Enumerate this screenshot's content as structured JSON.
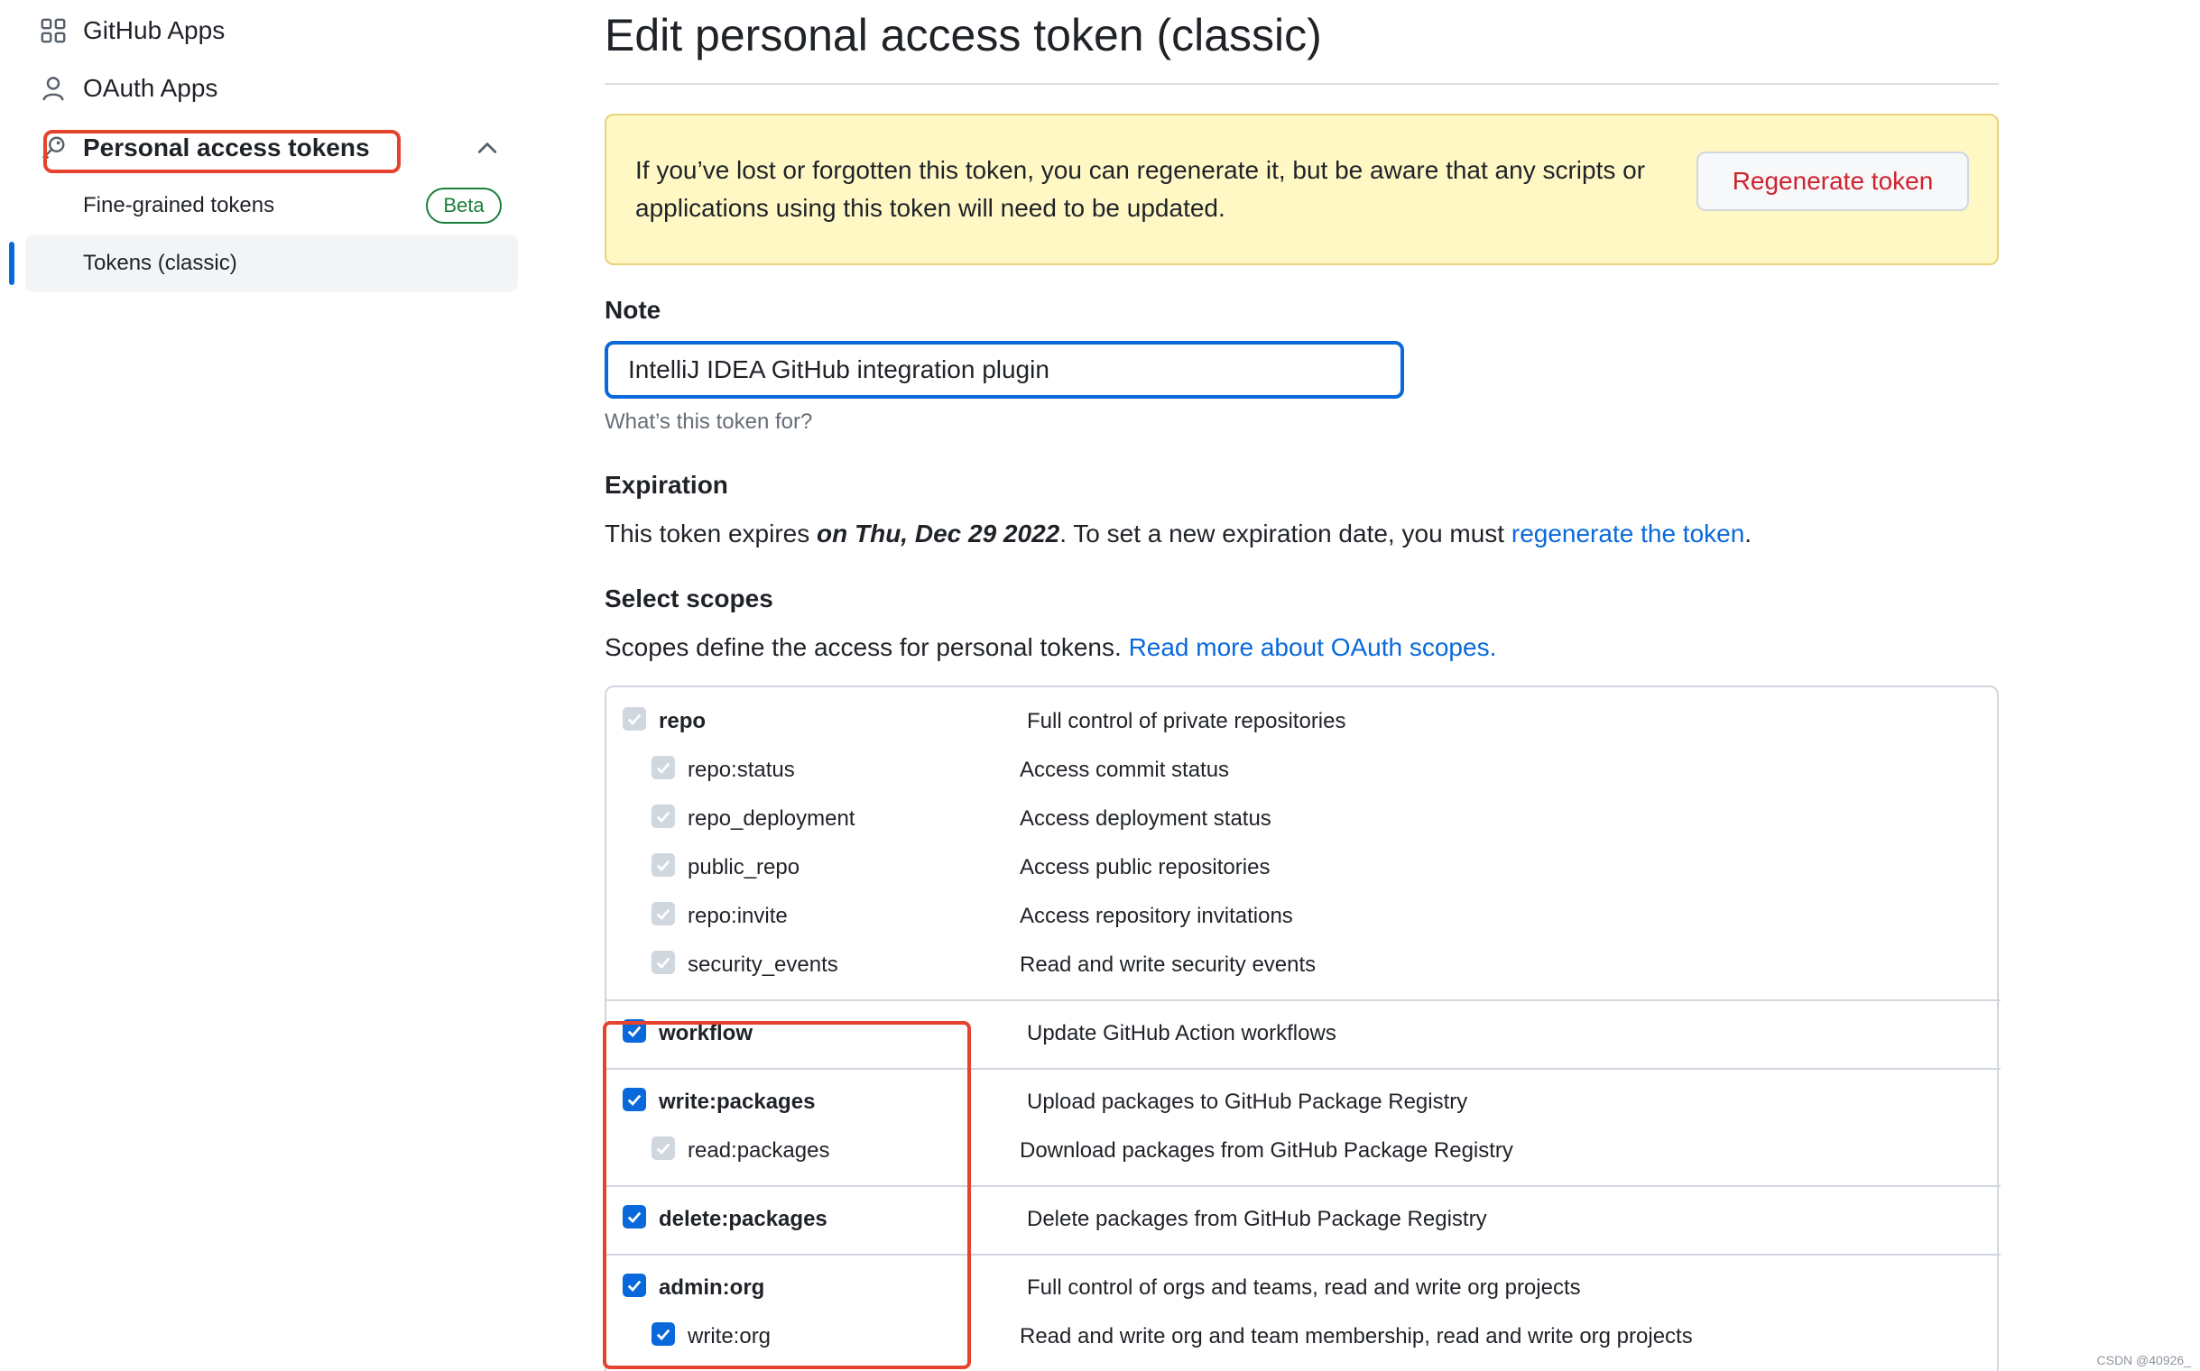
{
  "sidebar": {
    "items": [
      {
        "label": "GitHub Apps",
        "icon": "apps-grid-icon"
      },
      {
        "label": "OAuth Apps",
        "icon": "person-icon"
      },
      {
        "label": "Personal access tokens",
        "icon": "key-icon",
        "expanded": true
      }
    ],
    "sub_items": [
      {
        "label": "Fine-grained tokens",
        "badge": "Beta"
      },
      {
        "label": "Tokens (classic)",
        "selected": true
      }
    ]
  },
  "main": {
    "title": "Edit personal access token (classic)",
    "flash": {
      "message": "If you’ve lost or forgotten this token, you can regenerate it, but be aware that any scripts or applications using this token will need to be updated.",
      "button": "Regenerate token"
    },
    "note": {
      "label": "Note",
      "value": "IntelliJ IDEA GitHub integration plugin",
      "hint": "What’s this token for?"
    },
    "expiration": {
      "label": "Expiration",
      "text_before": "This token expires ",
      "date": "on Thu, Dec 29 2022",
      "text_after": ". To set a new expiration date, you must ",
      "link": "regenerate the token",
      "text_end": "."
    },
    "scopes": {
      "label": "Select scopes",
      "intro": "Scopes define the access for personal tokens. ",
      "intro_link": "Read more about OAuth scopes.",
      "groups": [
        {
          "name": "repo",
          "desc": "Full control of private repositories",
          "checked": false,
          "disabled": true,
          "children": [
            {
              "name": "repo:status",
              "desc": "Access commit status"
            },
            {
              "name": "repo_deployment",
              "desc": "Access deployment status"
            },
            {
              "name": "public_repo",
              "desc": "Access public repositories"
            },
            {
              "name": "repo:invite",
              "desc": "Access repository invitations"
            },
            {
              "name": "security_events",
              "desc": "Read and write security events"
            }
          ]
        },
        {
          "name": "workflow",
          "desc": "Update GitHub Action workflows",
          "checked": true
        },
        {
          "name": "write:packages",
          "desc": "Upload packages to GitHub Package Registry",
          "checked": true,
          "children": [
            {
              "name": "read:packages",
              "desc": "Download packages from GitHub Package Registry"
            }
          ]
        },
        {
          "name": "delete:packages",
          "desc": "Delete packages from GitHub Package Registry",
          "checked": true
        },
        {
          "name": "admin:org",
          "desc": "Full control of orgs and teams, read and write org projects",
          "checked": true,
          "children": [
            {
              "name": "write:org",
              "desc": "Read and write org and team membership, read and write org projects",
              "checked": true
            }
          ]
        }
      ]
    }
  },
  "watermark": "CSDN @40926_",
  "colors": {
    "accent": "#0969da",
    "danger": "#cf222e",
    "success": "#1a7f37",
    "flash_bg": "#fff8c5",
    "annotation": "#e5432d"
  }
}
